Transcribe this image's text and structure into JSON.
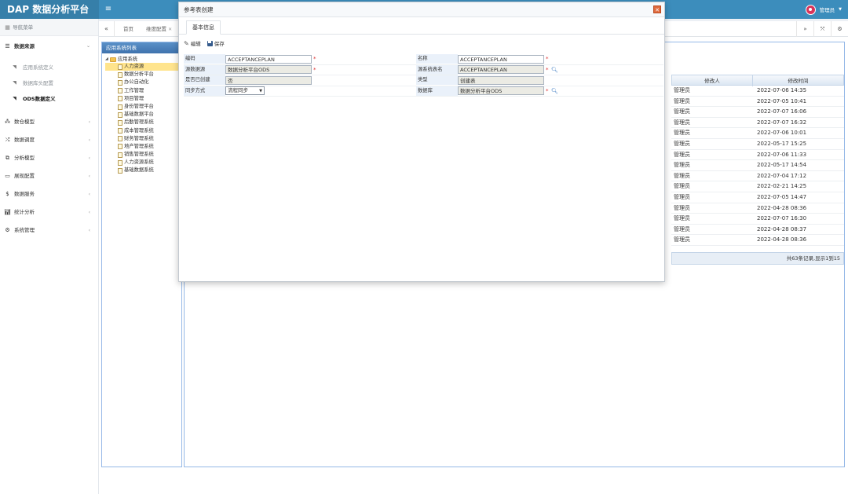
{
  "app": {
    "title": "DAP 数据分析平台",
    "user": "管理员"
  },
  "sidebar": {
    "header": "导航菜单",
    "sections": [
      {
        "label": "数据来源",
        "expanded": true,
        "icon": "database-icon",
        "children": [
          "应用系统定义",
          "数据库头配置",
          "ODS数据定义"
        ]
      },
      {
        "label": "数仓模型",
        "icon": "cubes-icon"
      },
      {
        "label": "数据调度",
        "icon": "shuffle-icon"
      },
      {
        "label": "分析模型",
        "icon": "sitemap-icon"
      },
      {
        "label": "展现配置",
        "icon": "desktop-icon"
      },
      {
        "label": "数据服务",
        "icon": "dollar-icon"
      },
      {
        "label": "统计分析",
        "icon": "bar-chart-icon"
      },
      {
        "label": "系统管理",
        "icon": "gear-icon"
      }
    ]
  },
  "tabs": [
    "首页",
    "维度配置"
  ],
  "tree": {
    "title": "应用系统列表",
    "root": "应用系统",
    "items": [
      "人力资源",
      "数据分析平台",
      "办公自动化",
      "工作管理",
      "项目管理",
      "身份管理平台",
      "基础数据平台",
      "后勤管理系统",
      "成本管理系统",
      "财务管理系统",
      "地产管理系统",
      "销售管理系统",
      "人力资源系统",
      "基础数据系统"
    ]
  },
  "grid": {
    "columns": [
      "修改人",
      "修改时间"
    ],
    "rows": [
      [
        "管理员",
        "2022-07-06 14:35"
      ],
      [
        "管理员",
        "2022-07-05 10:41"
      ],
      [
        "管理员",
        "2022-07-07 16:06"
      ],
      [
        "管理员",
        "2022-07-07 16:32"
      ],
      [
        "管理员",
        "2022-07-06 10:01"
      ],
      [
        "管理员",
        "2022-05-17 15:25"
      ],
      [
        "管理员",
        "2022-07-06 11:33"
      ],
      [
        "管理员",
        "2022-05-17 14:54"
      ],
      [
        "管理员",
        "2022-07-04 17:12"
      ],
      [
        "管理员",
        "2022-02-21 14:25"
      ],
      [
        "管理员",
        "2022-07-05 14:47"
      ],
      [
        "管理员",
        "2022-04-28 08:36"
      ],
      [
        "管理员",
        "2022-07-07 16:30"
      ],
      [
        "管理员",
        "2022-04-28 08:37"
      ],
      [
        "管理员",
        "2022-04-28 08:36"
      ]
    ],
    "pager": "共63条记录,显示1到15"
  },
  "dialog": {
    "title": "参考表创建",
    "tab": "基本信息",
    "edit_label": "编辑",
    "save_label": "保存",
    "fields": {
      "code_label": "编码",
      "code_value": "ACCEPTANCEPLAN",
      "name_label": "名称",
      "name_value": "ACCEPTANCEPLAN",
      "source_label": "源数据源",
      "source_value": "数据分析平台ODS",
      "src_table_label": "源系统表名",
      "src_table_value": "ACCEPTANCEPLAN",
      "created_label": "是否已创建",
      "created_value": "否",
      "type_label": "类型",
      "type_value": "创建表",
      "sync_label": "同步方式",
      "sync_value": "流程同步",
      "db_label": "数据库",
      "db_value": "数据分析平台ODS"
    }
  }
}
